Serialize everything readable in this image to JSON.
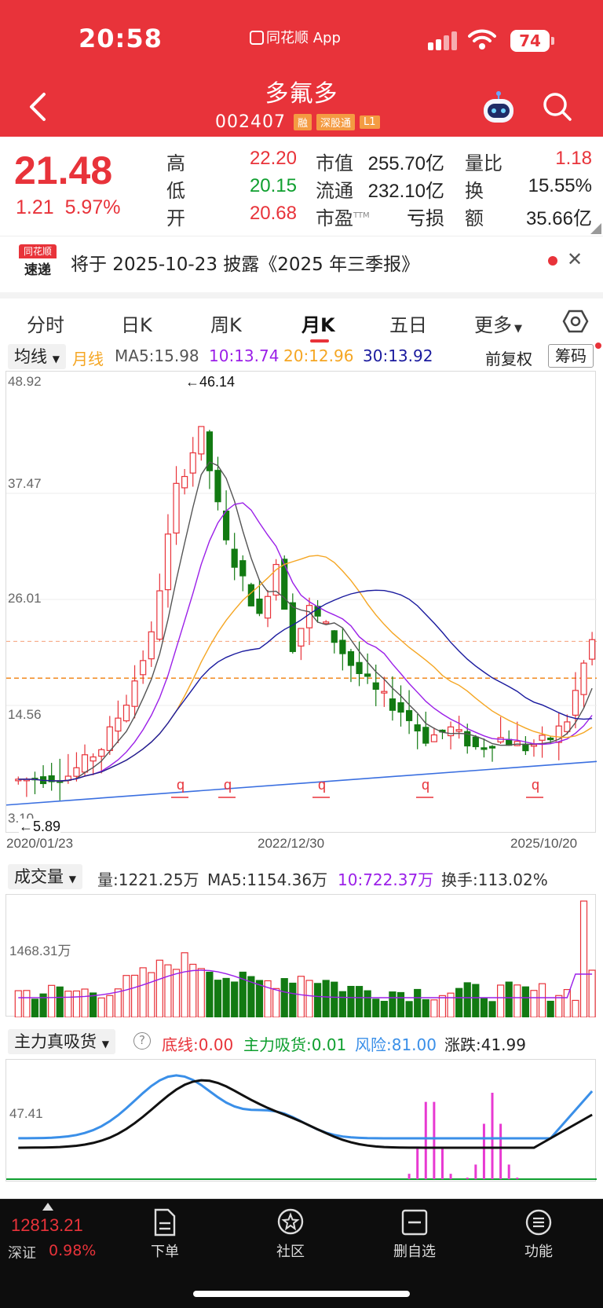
{
  "status": {
    "time": "20:58",
    "app_label": "同花顺 App",
    "battery": "74"
  },
  "header": {
    "stock_name": "多氟多",
    "stock_code": "002407",
    "tags": [
      "融",
      "深股通",
      "L1"
    ]
  },
  "quote": {
    "price": "21.48",
    "change": "1.21",
    "change_pct": "5.97%",
    "high_label": "高",
    "high": "22.20",
    "low_label": "低",
    "low": "20.15",
    "open_label": "开",
    "open": "20.68",
    "mktcap_label": "市值",
    "mktcap": "255.70亿",
    "float_label": "流通",
    "float": "232.10亿",
    "pe_label": "市盈",
    "pe_sup": "TTM",
    "pe": "亏损",
    "volratio_label": "量比",
    "volratio": "1.18",
    "turnover_label": "换",
    "turnover": "15.55%",
    "amount_label": "额",
    "amount": "35.66亿"
  },
  "notice": {
    "logo_top": "同花顺",
    "logo_bottom": "速递",
    "text": "将于 2025-10-23 披露《2025 年三季报》"
  },
  "tabs": [
    "分时",
    "日K",
    "周K",
    "月K",
    "五日",
    "更多"
  ],
  "active_tab": 3,
  "ma_row": {
    "selector": "均线",
    "line_type": "月线",
    "ma5": "MA5:15.98",
    "ma10": "10:13.74",
    "ma20": "20:12.96",
    "ma30": "30:13.92",
    "adjust": "前复权",
    "chips": "筹码"
  },
  "kline": {
    "y_labels": [
      "48.92",
      "37.47",
      "26.01",
      "14.56",
      "3.10"
    ],
    "max_marker": "←46.14",
    "min_marker": "←5.89",
    "dates": [
      "2020/01/23",
      "2022/12/30",
      "2025/10/20"
    ],
    "colors": {
      "up": "#e8333a",
      "down": "#127a12",
      "ma5": "#555555",
      "ma10": "#9b1fe8",
      "ma20": "#f5a623",
      "ma30": "#1a1a9e",
      "trend": "#3a6fe0"
    }
  },
  "volume": {
    "selector": "成交量",
    "vol": "量:1221.25万",
    "ma5": "MA5:1154.36万",
    "ma10": "10:722.37万",
    "turnover": "换手:113.02%",
    "y_label": "1468.31万"
  },
  "indicator": {
    "selector": "主力真吸货",
    "help": "?",
    "bottom": "底线:0.00",
    "absorb": "主力吸货:0.01",
    "risk": "风险:81.00",
    "change": "涨跌:41.99",
    "y_label": "47.41"
  },
  "bottom_bar": {
    "index_value": "12813.21",
    "index_name": "深证",
    "index_pct": "0.98%",
    "nav": [
      "下单",
      "社区",
      "删自选",
      "功能"
    ]
  }
}
